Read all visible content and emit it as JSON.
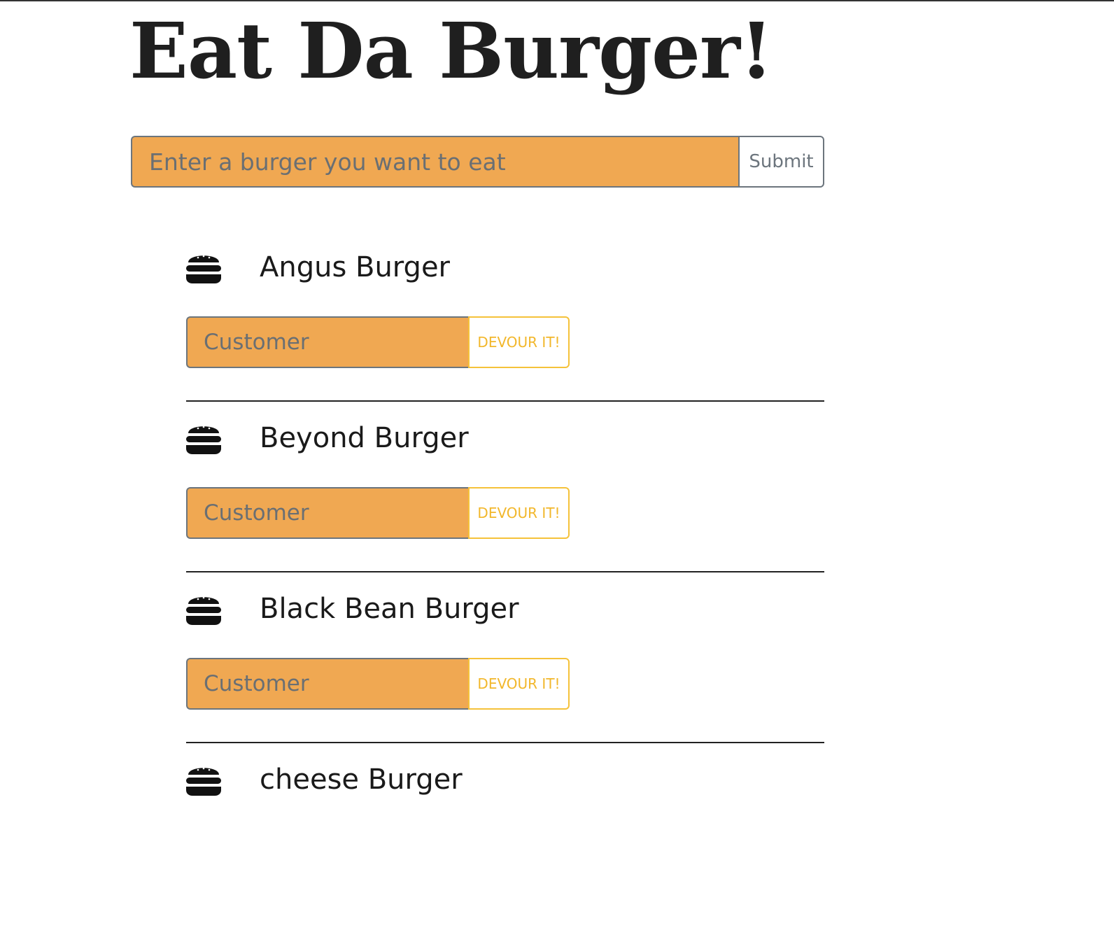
{
  "header": {
    "title": "Eat Da Burger!"
  },
  "add_form": {
    "placeholder": "Enter a burger you want to eat",
    "submit_label": "Submit"
  },
  "burgers": [
    {
      "name": "Angus Burger",
      "customer_placeholder": "Customer",
      "button_label": "DEVOUR IT!"
    },
    {
      "name": "Beyond Burger",
      "customer_placeholder": "Customer",
      "button_label": "DEVOUR IT!"
    },
    {
      "name": "Black Bean Burger",
      "customer_placeholder": "Customer",
      "button_label": "DEVOUR IT!"
    },
    {
      "name": "cheese Burger"
    }
  ],
  "icons": {
    "burger": "burger-icon"
  },
  "colors": {
    "input_bg": "#f0a852",
    "devour_accent": "#f5c23a",
    "border_gray": "#6c757d"
  }
}
